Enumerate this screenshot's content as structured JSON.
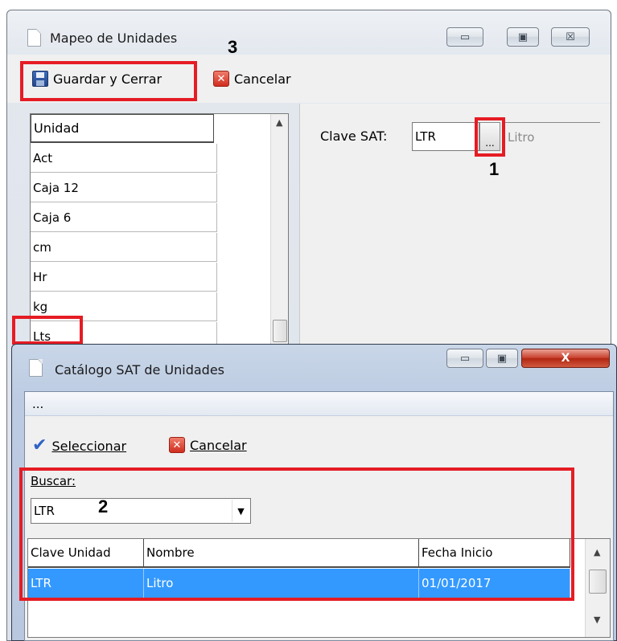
{
  "mapping_window": {
    "title": "Mapeo de Unidades",
    "minimize_glyph": "▭",
    "maximize_glyph": "▣",
    "close_glyph": "☒",
    "toolbar": {
      "save_label": "Guardar y Cerrar",
      "cancel_label": "Cancelar"
    },
    "unit_list": {
      "header": "Unidad",
      "items": [
        "Act",
        "Caja 12",
        "Caja 6",
        "cm",
        "Hr",
        "kg",
        "Lts"
      ]
    },
    "sat_key": {
      "label": "Clave SAT:",
      "value": "LTR",
      "browse_label": "...",
      "description": "Litro"
    }
  },
  "catalog_window": {
    "title": "Catálogo SAT de Unidades",
    "menu_item": "...",
    "toolbar": {
      "select_label": "Seleccionar",
      "cancel_label": "Cancelar"
    },
    "search": {
      "label": "Buscar:",
      "value": "LTR"
    },
    "grid": {
      "columns": [
        "Clave Unidad",
        "Nombre",
        "Fecha Inicio"
      ],
      "rows": [
        {
          "clave": "LTR",
          "nombre": "Litro",
          "fecha": "01/01/2017"
        }
      ]
    }
  },
  "annotations": {
    "step1": "1",
    "step2": "2",
    "step3": "3"
  },
  "colors": {
    "highlight_box": "#e51c24",
    "selection": "#3399ff"
  }
}
